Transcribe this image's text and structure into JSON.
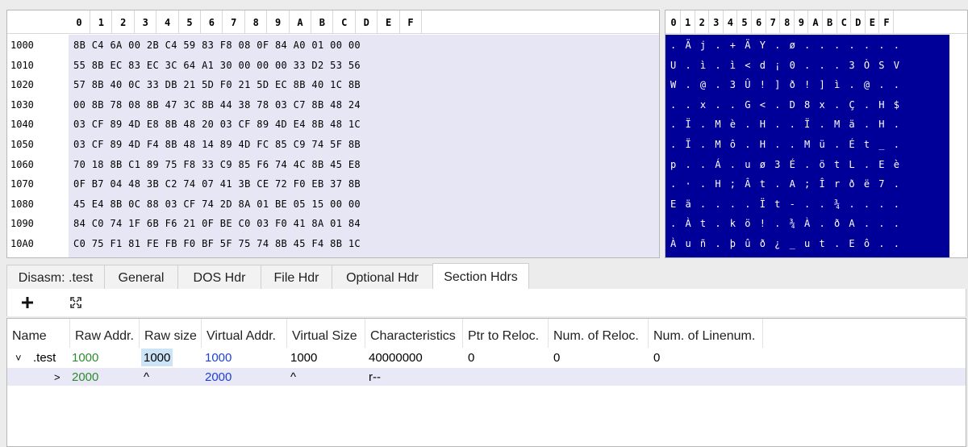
{
  "hex_view": {
    "columns": [
      "0",
      "1",
      "2",
      "3",
      "4",
      "5",
      "6",
      "7",
      "8",
      "9",
      "A",
      "B",
      "C",
      "D",
      "E",
      "F"
    ],
    "rows": [
      {
        "addr": "1000",
        "bytes": "8B C4 6A 00 2B C4 59 83 F8 08 0F 84 A0 01 00 00",
        "ascii": ". Ä j . + Ä Y . ø . . . . . . ."
      },
      {
        "addr": "1010",
        "bytes": "55 8B EC 83 EC 3C 64 A1 30 00 00 00 33 D2 53 56",
        "ascii": "U . ì . ì < d ¡ 0 . . . 3 Ò S V"
      },
      {
        "addr": "1020",
        "bytes": "57 8B 40 0C 33 DB 21 5D F0 21 5D EC 8B 40 1C 8B",
        "ascii": "W . @ . 3 Û ! ] ð ! ] ì . @ . ."
      },
      {
        "addr": "1030",
        "bytes": "00 8B 78 08 8B 47 3C 8B 44 38 78 03 C7 8B 48 24",
        "ascii": ". . x . . G < . D 8 x . Ç . H $"
      },
      {
        "addr": "1040",
        "bytes": "03 CF 89 4D E8 8B 48 20 03 CF 89 4D E4 8B 48 1C",
        "ascii": ". Ï . M è . H . . Ï . M ä . H ."
      },
      {
        "addr": "1050",
        "bytes": "03 CF 89 4D F4 8B 48 14 89 4D FC 85 C9 74 5F 8B",
        "ascii": ". Ï . M ô . H . . M ü . É t _ ."
      },
      {
        "addr": "1060",
        "bytes": "70 18 8B C1 89 75 F8 33 C9 85 F6 74 4C 8B 45 E8",
        "ascii": "p . . Á . u ø 3 É . ö t L . E è"
      },
      {
        "addr": "1070",
        "bytes": "0F B7 04 48 3B C2 74 07 41 3B CE 72 F0 EB 37 8B",
        "ascii": ". · . H ; Â t . A ; Î r ð ë 7 ."
      },
      {
        "addr": "1080",
        "bytes": "45 E4 8B 0C 88 03 CF 74 2D 8A 01 BE 05 15 00 00",
        "ascii": "E ä . . . . Ï t - . . ¾ . . . ."
      },
      {
        "addr": "1090",
        "bytes": "84 C0 74 1F 6B F6 21 0F BE C0 03 F0 41 8A 01 84",
        "ascii": ". À t . k ö ! . ¾ À . ð A . . ."
      },
      {
        "addr": "10A0",
        "bytes": "C0 75 F1 81 FE FB F0 BF 5F 75 74 8B 45 F4 8B 1C",
        "ascii": "À u ñ . þ û ð ¿ _ u t . E ô . ."
      }
    ]
  },
  "tabs": [
    "Disasm: .test",
    "General",
    "DOS Hdr",
    "File Hdr",
    "Optional Hdr",
    "Section Hdrs"
  ],
  "active_tab": "Section Hdrs",
  "toolbar": {
    "add_icon": "plus-icon",
    "fit_icon": "fit-columns-icon"
  },
  "section_table": {
    "headers": [
      "Name",
      "Raw Addr.",
      "Raw size",
      "Virtual Addr.",
      "Virtual Size",
      "Characteristics",
      "Ptr to Reloc.",
      "Num. of Reloc.",
      "Num. of Linenum."
    ],
    "rows": [
      {
        "expander": "˅",
        "name": ".test",
        "raw_addr": "1000",
        "raw_size": "1000",
        "virtual_addr": "1000",
        "virtual_size": "1000",
        "characteristics": "40000000",
        "ptr_reloc": "0",
        "num_reloc": "0",
        "num_linenum": "0"
      },
      {
        "expander": ">",
        "name": "",
        "raw_addr": "2000",
        "raw_size": "^",
        "virtual_addr": "2000",
        "virtual_size": "^",
        "characteristics": "r--",
        "ptr_reloc": "",
        "num_reloc": "",
        "num_linenum": ""
      }
    ]
  },
  "colors": {
    "ascii_bg": "#000099",
    "hex_bg": "#e6e6f4",
    "raw_addr": "#2e8b2e",
    "virtual_addr": "#1f3fd6",
    "selection": "#cde4f7"
  }
}
